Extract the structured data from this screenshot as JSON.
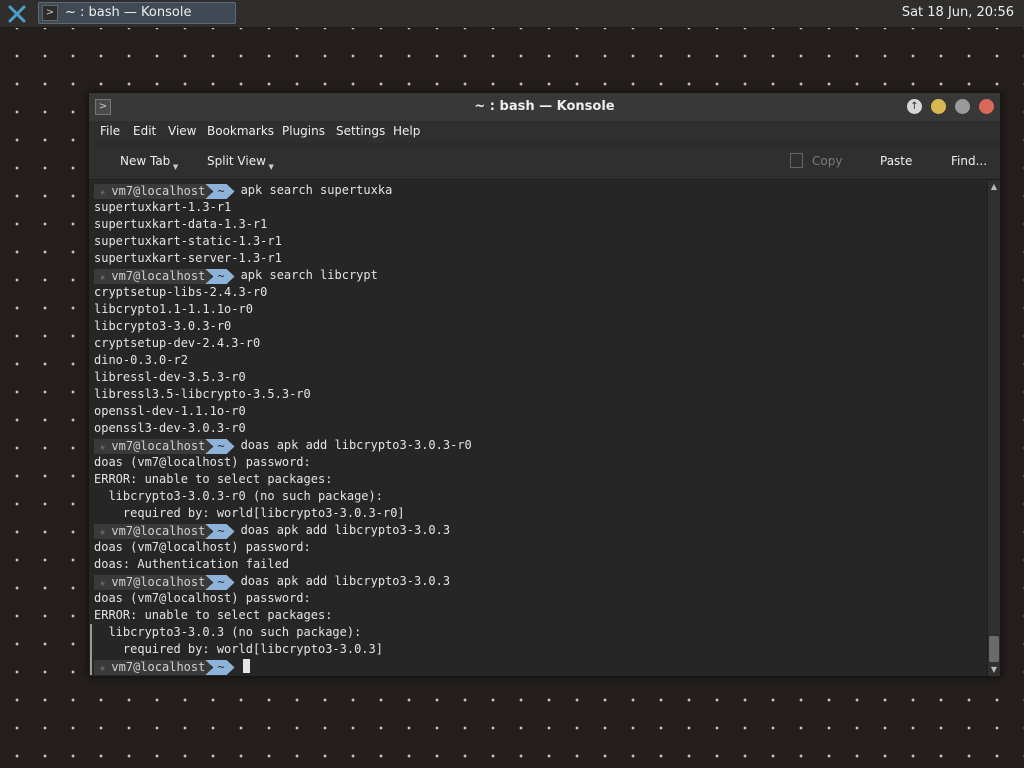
{
  "panel": {
    "task_label": "~ : bash — Konsole",
    "clock": "Sat 18 Jun, 20:56"
  },
  "window": {
    "title": "~ : bash — Konsole"
  },
  "menu": [
    "File",
    "Edit",
    "View",
    "Bookmarks",
    "Plugins",
    "Settings",
    "Help"
  ],
  "toolbar": {
    "new_tab": "New Tab",
    "split_view": "Split View",
    "copy": "Copy",
    "paste": "Paste",
    "find": "Find..."
  },
  "prompt": {
    "user": "vm7@localhost",
    "dir": "~"
  },
  "terminal_lines": [
    {
      "type": "prompt",
      "cmd": "apk search supertuxka"
    },
    {
      "type": "out",
      "text": "supertuxkart-1.3-r1"
    },
    {
      "type": "out",
      "text": "supertuxkart-data-1.3-r1"
    },
    {
      "type": "out",
      "text": "supertuxkart-static-1.3-r1"
    },
    {
      "type": "out",
      "text": "supertuxkart-server-1.3-r1"
    },
    {
      "type": "prompt",
      "cmd": "apk search libcrypt"
    },
    {
      "type": "out",
      "text": "cryptsetup-libs-2.4.3-r0"
    },
    {
      "type": "out",
      "text": "libcrypto1.1-1.1.1o-r0"
    },
    {
      "type": "out",
      "text": "libcrypto3-3.0.3-r0"
    },
    {
      "type": "out",
      "text": "cryptsetup-dev-2.4.3-r0"
    },
    {
      "type": "out",
      "text": "dino-0.3.0-r2"
    },
    {
      "type": "out",
      "text": "libressl-dev-3.5.3-r0"
    },
    {
      "type": "out",
      "text": "libressl3.5-libcrypto-3.5.3-r0"
    },
    {
      "type": "out",
      "text": "openssl-dev-1.1.1o-r0"
    },
    {
      "type": "out",
      "text": "openssl3-dev-3.0.3-r0"
    },
    {
      "type": "prompt",
      "cmd": "doas apk add libcrypto3-3.0.3-r0"
    },
    {
      "type": "out",
      "text": "doas (vm7@localhost) password:"
    },
    {
      "type": "out",
      "text": "ERROR: unable to select packages:"
    },
    {
      "type": "out",
      "text": "  libcrypto3-3.0.3-r0 (no such package):"
    },
    {
      "type": "out",
      "text": "    required by: world[libcrypto3-3.0.3-r0]"
    },
    {
      "type": "prompt",
      "cmd": "doas apk add libcrypto3-3.0.3"
    },
    {
      "type": "out",
      "text": "doas (vm7@localhost) password:"
    },
    {
      "type": "out",
      "text": "doas: Authentication failed"
    },
    {
      "type": "prompt",
      "cmd": "doas apk add libcrypto3-3.0.3"
    },
    {
      "type": "out",
      "text": "doas (vm7@localhost) password:"
    },
    {
      "type": "out",
      "text": "ERROR: unable to select packages:"
    },
    {
      "type": "out",
      "text": "  libcrypto3-3.0.3 (no such package):"
    },
    {
      "type": "out",
      "text": "    required by: world[libcrypto3-3.0.3]"
    },
    {
      "type": "prompt",
      "cmd": ""
    }
  ],
  "icons": {
    "launcher": "kde-launcher-icon",
    "terminal": "terminal-icon",
    "keep_above": "keep-above-icon",
    "copy": "copy-icon"
  },
  "colors": {
    "prompt_dir_bg": "#8fb2d8",
    "close": "#d9685a",
    "minimize": "#d8b84f",
    "maximize": "#9a9a9a"
  }
}
